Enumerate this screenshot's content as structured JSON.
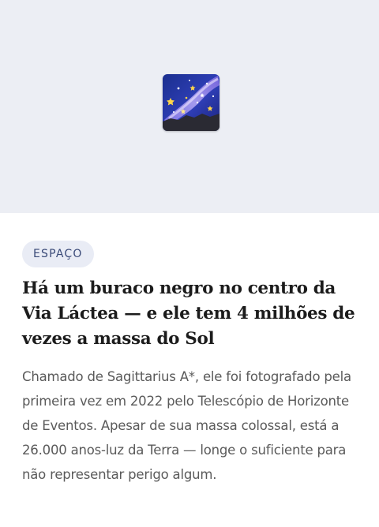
{
  "article": {
    "category": "ESPAÇO",
    "headline": "Há um buraco negro no centro da Via Láctea — e ele tem 4 milhões de vezes a massa do Sol",
    "summary": "Chamado de Sagittarius A*, ele foi fotografado pela primeira vez em 2022 pelo Telescópio de Horizonte de Eventos. Apesar de sua massa colossal, está a 26.000 anos-luz da Terra — longe o suficiente para não representar perigo algum."
  },
  "hero": {
    "icon": "milky-way-icon",
    "background_color": "#eceef4"
  },
  "colors": {
    "badge_bg": "#e9ecf5",
    "badge_text": "#3a4a78",
    "headline_text": "#1c1c1c",
    "summary_text": "#5a5a5a"
  }
}
